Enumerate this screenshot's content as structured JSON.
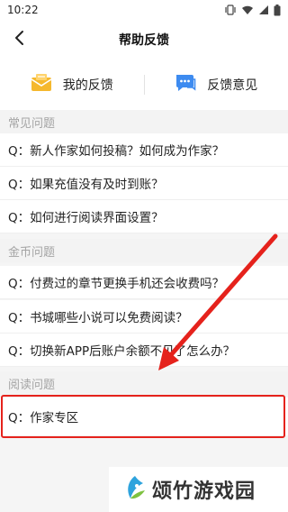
{
  "status_bar": {
    "time": "10:22",
    "icons": [
      "vibrate-icon",
      "wifi-icon",
      "signal-icon",
      "battery-icon"
    ]
  },
  "header": {
    "title": "帮助反馈",
    "back_icon": "back-arrow-icon"
  },
  "shortcuts": [
    {
      "label": "我的反馈",
      "icon": "envelope-icon",
      "icon_color": "#f5b82e"
    },
    {
      "label": "反馈意见",
      "icon": "chat-bubble-icon",
      "icon_color": "#3d8bf0"
    }
  ],
  "sections": [
    {
      "title": "常见问题",
      "items": [
        "Q：新人作家如何投稿？如何成为作家？",
        "Q：如果充值没有及时到账？",
        "Q：如何进行阅读界面设置？"
      ]
    },
    {
      "title": "金币问题",
      "items": [
        "Q：付费过的章节更换手机还会收费吗？",
        "Q：书城哪些小说可以免费阅读？",
        "Q：切换新APP后账户余额不见了怎么办？"
      ]
    },
    {
      "title": "阅读问题",
      "items": [
        "Q：作家专区"
      ]
    }
  ],
  "annotation": {
    "color": "#e5221c"
  },
  "watermark": {
    "text": "颂竹游戏园"
  }
}
